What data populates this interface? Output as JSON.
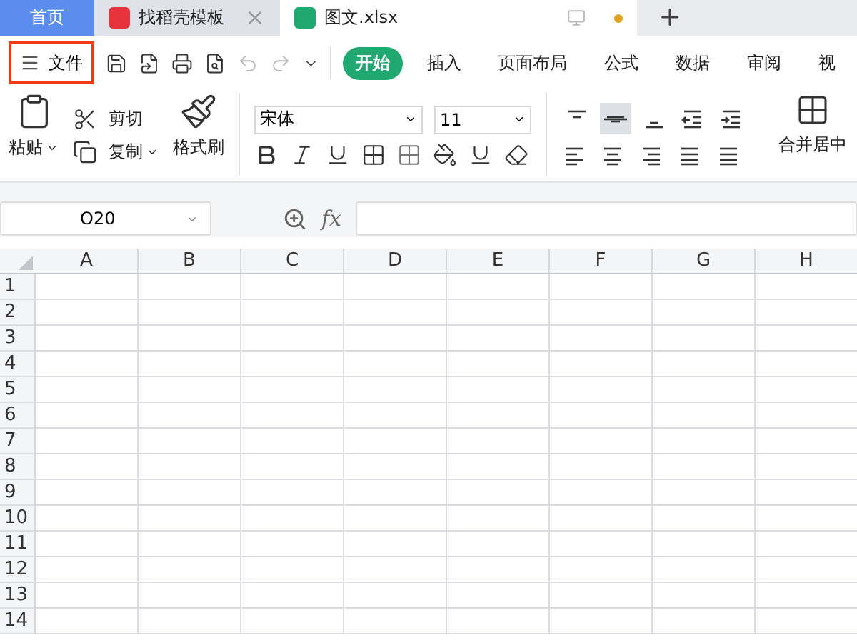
{
  "tabs": [
    {
      "label": "首页",
      "kind": "home",
      "selected": false
    },
    {
      "label": "找稻壳模板",
      "kind": "template",
      "selected": false
    },
    {
      "label": "图文.xlsx",
      "kind": "sheet",
      "selected": true
    }
  ],
  "menu_button": {
    "label": "文件",
    "highlighted": true
  },
  "ribbon_tabs": [
    {
      "label": "开始",
      "selected": true
    },
    {
      "label": "插入",
      "selected": false
    },
    {
      "label": "页面布局",
      "selected": false
    },
    {
      "label": "公式",
      "selected": false
    },
    {
      "label": "数据",
      "selected": false
    },
    {
      "label": "审阅",
      "selected": false
    },
    {
      "label": "视",
      "selected": false
    }
  ],
  "clipboard": {
    "paste": "粘贴",
    "cut": "剪切",
    "copy": "复制",
    "format_painter": "格式刷"
  },
  "font": {
    "name": "宋体",
    "size": "11"
  },
  "vertical_align": [
    {
      "kind": "top",
      "selected": false
    },
    {
      "kind": "middle",
      "selected": true
    },
    {
      "kind": "bottom",
      "selected": false
    }
  ],
  "merge": {
    "label": "合并居中"
  },
  "name_box": {
    "value": "O20"
  },
  "formula_bar": {
    "fx_label": "fx"
  },
  "sheet": {
    "columns": [
      "A",
      "B",
      "C",
      "D",
      "E",
      "F",
      "G",
      "H"
    ],
    "rows": [
      "1",
      "2",
      "3",
      "4",
      "5",
      "6",
      "7",
      "8",
      "9",
      "10",
      "11",
      "12",
      "13",
      "14"
    ]
  }
}
